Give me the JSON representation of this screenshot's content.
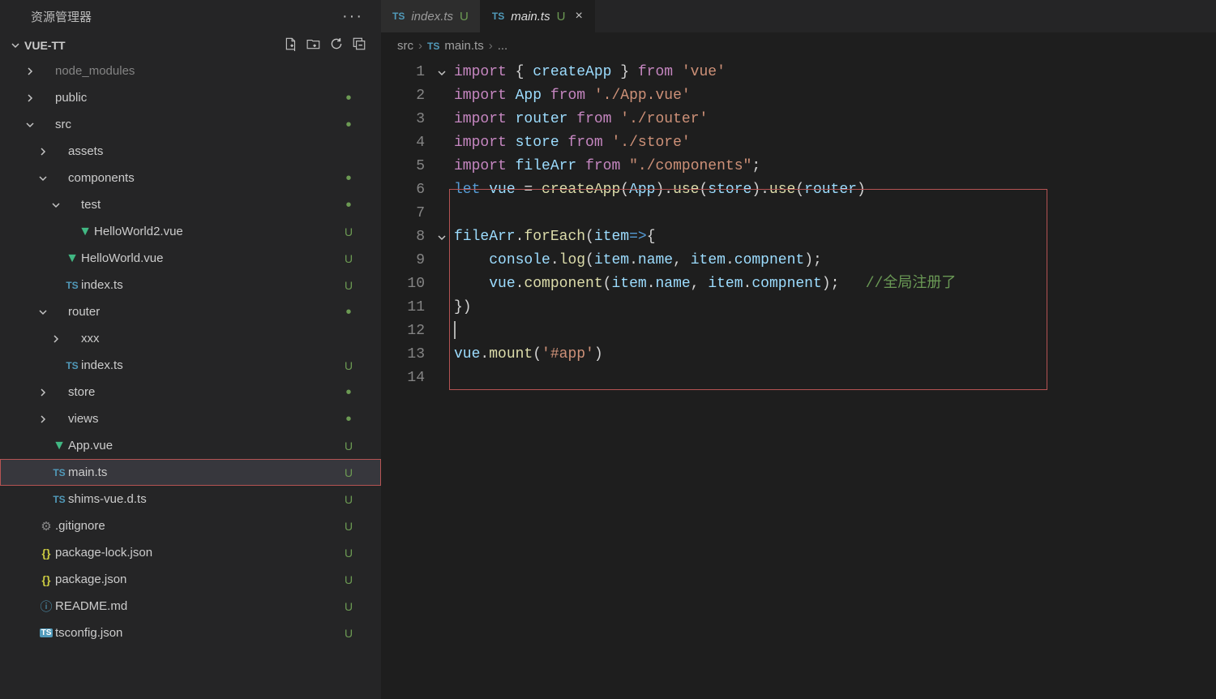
{
  "explorer": {
    "title": "资源管理器",
    "project": "VUE-TT",
    "tree": [
      {
        "depth": 0,
        "chev": "right",
        "iconType": "none",
        "label": "node_modules",
        "dim": true,
        "git": ""
      },
      {
        "depth": 0,
        "chev": "right",
        "iconType": "none",
        "label": "public",
        "git": "dot"
      },
      {
        "depth": 0,
        "chev": "down",
        "iconType": "none",
        "label": "src",
        "git": "dot"
      },
      {
        "depth": 1,
        "chev": "right",
        "iconType": "none",
        "label": "assets",
        "git": ""
      },
      {
        "depth": 1,
        "chev": "down",
        "iconType": "none",
        "label": "components",
        "git": "dot"
      },
      {
        "depth": 2,
        "chev": "down",
        "iconType": "none",
        "label": "test",
        "git": "dot"
      },
      {
        "depth": 3,
        "chev": "",
        "iconType": "vue",
        "label": "HelloWorld2.vue",
        "git": "U"
      },
      {
        "depth": 2,
        "chev": "",
        "iconType": "vue",
        "label": "HelloWorld.vue",
        "git": "U"
      },
      {
        "depth": 2,
        "chev": "",
        "iconType": "ts",
        "label": "index.ts",
        "git": "U"
      },
      {
        "depth": 1,
        "chev": "down",
        "iconType": "none",
        "label": "router",
        "git": "dot"
      },
      {
        "depth": 2,
        "chev": "right",
        "iconType": "none",
        "label": "xxx",
        "git": ""
      },
      {
        "depth": 2,
        "chev": "",
        "iconType": "ts",
        "label": "index.ts",
        "git": "U"
      },
      {
        "depth": 1,
        "chev": "right",
        "iconType": "none",
        "label": "store",
        "git": "dot"
      },
      {
        "depth": 1,
        "chev": "right",
        "iconType": "none",
        "label": "views",
        "git": "dot"
      },
      {
        "depth": 1,
        "chev": "",
        "iconType": "vue",
        "label": "App.vue",
        "git": "U"
      },
      {
        "depth": 1,
        "chev": "",
        "iconType": "ts",
        "label": "main.ts",
        "git": "U",
        "selected": true,
        "highlighted": true
      },
      {
        "depth": 1,
        "chev": "",
        "iconType": "ts",
        "label": "shims-vue.d.ts",
        "git": "U"
      },
      {
        "depth": 0,
        "chev": "",
        "iconType": "gear",
        "label": ".gitignore",
        "git": "U"
      },
      {
        "depth": 0,
        "chev": "",
        "iconType": "json",
        "label": "package-lock.json",
        "git": "U"
      },
      {
        "depth": 0,
        "chev": "",
        "iconType": "json",
        "label": "package.json",
        "git": "U"
      },
      {
        "depth": 0,
        "chev": "",
        "iconType": "info",
        "label": "README.md",
        "git": "U"
      },
      {
        "depth": 0,
        "chev": "",
        "iconType": "tsc",
        "label": "tsconfig.json",
        "git": "U"
      }
    ]
  },
  "tabs": [
    {
      "icon": "ts",
      "label": "index.ts",
      "git": "U",
      "active": false,
      "close": false
    },
    {
      "icon": "ts",
      "label": "main.ts",
      "git": "U",
      "active": true,
      "close": true
    }
  ],
  "breadcrumb": {
    "parts": [
      "src",
      "main.ts",
      "..."
    ],
    "icon": "ts"
  },
  "code": {
    "lines": [
      {
        "n": 1,
        "fold": "down",
        "tokens": [
          [
            "k-import",
            "import"
          ],
          [
            "tok-punct",
            " { "
          ],
          [
            "tok-ident",
            "createApp"
          ],
          [
            "tok-punct",
            " } "
          ],
          [
            "k-from",
            "from"
          ],
          [
            "tok-punct",
            " "
          ],
          [
            "tok-str",
            "'vue'"
          ]
        ]
      },
      {
        "n": 2,
        "tokens": [
          [
            "k-import",
            "import"
          ],
          [
            "tok-punct",
            " "
          ],
          [
            "tok-ident",
            "App"
          ],
          [
            "tok-punct",
            " "
          ],
          [
            "k-from",
            "from"
          ],
          [
            "tok-punct",
            " "
          ],
          [
            "tok-str",
            "'./App.vue'"
          ]
        ]
      },
      {
        "n": 3,
        "tokens": [
          [
            "k-import",
            "import"
          ],
          [
            "tok-punct",
            " "
          ],
          [
            "tok-ident",
            "router"
          ],
          [
            "tok-punct",
            " "
          ],
          [
            "k-from",
            "from"
          ],
          [
            "tok-punct",
            " "
          ],
          [
            "tok-str",
            "'./router'"
          ]
        ]
      },
      {
        "n": 4,
        "tokens": [
          [
            "k-import",
            "import"
          ],
          [
            "tok-punct",
            " "
          ],
          [
            "tok-ident",
            "store"
          ],
          [
            "tok-punct",
            " "
          ],
          [
            "k-from",
            "from"
          ],
          [
            "tok-punct",
            " "
          ],
          [
            "tok-str",
            "'./store'"
          ]
        ]
      },
      {
        "n": 5,
        "tokens": [
          [
            "k-import",
            "import"
          ],
          [
            "tok-punct",
            " "
          ],
          [
            "tok-ident",
            "fileArr"
          ],
          [
            "tok-punct",
            " "
          ],
          [
            "k-from",
            "from"
          ],
          [
            "tok-punct",
            " "
          ],
          [
            "tok-str",
            "\"./components\""
          ],
          [
            "tok-punct",
            ";"
          ]
        ]
      },
      {
        "n": 6,
        "tokens": [
          [
            "k-let",
            "let"
          ],
          [
            "tok-punct",
            " "
          ],
          [
            "tok-ident",
            "vue"
          ],
          [
            "tok-punct",
            " = "
          ],
          [
            "tok-func",
            "createApp"
          ],
          [
            "tok-punct",
            "("
          ],
          [
            "tok-ident",
            "App"
          ],
          [
            "tok-punct",
            ")."
          ],
          [
            "tok-func",
            "use"
          ],
          [
            "tok-punct",
            "("
          ],
          [
            "tok-ident",
            "store"
          ],
          [
            "tok-punct",
            ")."
          ],
          [
            "tok-func",
            "use"
          ],
          [
            "tok-punct",
            "("
          ],
          [
            "tok-ident",
            "router"
          ],
          [
            "tok-punct",
            ")"
          ]
        ]
      },
      {
        "n": 7,
        "tokens": []
      },
      {
        "n": 8,
        "fold": "down",
        "tokens": [
          [
            "tok-ident",
            "fileArr"
          ],
          [
            "tok-punct",
            "."
          ],
          [
            "tok-func",
            "forEach"
          ],
          [
            "tok-punct",
            "("
          ],
          [
            "tok-ident",
            "item"
          ],
          [
            "k-let",
            "=>"
          ],
          [
            "tok-punct",
            "{"
          ]
        ]
      },
      {
        "n": 9,
        "tokens": [
          [
            "tok-punct",
            "    "
          ],
          [
            "tok-ident",
            "console"
          ],
          [
            "tok-punct",
            "."
          ],
          [
            "tok-func",
            "log"
          ],
          [
            "tok-punct",
            "("
          ],
          [
            "tok-ident",
            "item"
          ],
          [
            "tok-punct",
            "."
          ],
          [
            "tok-ident",
            "name"
          ],
          [
            "tok-punct",
            ", "
          ],
          [
            "tok-ident",
            "item"
          ],
          [
            "tok-punct",
            "."
          ],
          [
            "tok-ident",
            "compnent"
          ],
          [
            "tok-punct",
            ");"
          ]
        ]
      },
      {
        "n": 10,
        "tokens": [
          [
            "tok-punct",
            "    "
          ],
          [
            "tok-ident",
            "vue"
          ],
          [
            "tok-punct",
            "."
          ],
          [
            "tok-func",
            "component"
          ],
          [
            "tok-punct",
            "("
          ],
          [
            "tok-ident",
            "item"
          ],
          [
            "tok-punct",
            "."
          ],
          [
            "tok-ident",
            "name"
          ],
          [
            "tok-punct",
            ", "
          ],
          [
            "tok-ident",
            "item"
          ],
          [
            "tok-punct",
            "."
          ],
          [
            "tok-ident",
            "compnent"
          ],
          [
            "tok-punct",
            ");   "
          ],
          [
            "tok-comment",
            "//全局注册了"
          ]
        ]
      },
      {
        "n": 11,
        "tokens": [
          [
            "tok-punct",
            "})"
          ]
        ]
      },
      {
        "n": 12,
        "cursor": true,
        "tokens": []
      },
      {
        "n": 13,
        "tokens": [
          [
            "tok-ident",
            "vue"
          ],
          [
            "tok-punct",
            "."
          ],
          [
            "tok-func",
            "mount"
          ],
          [
            "tok-punct",
            "("
          ],
          [
            "tok-str",
            "'#app'"
          ],
          [
            "tok-punct",
            ")"
          ]
        ]
      },
      {
        "n": 14,
        "tokens": []
      }
    ]
  }
}
